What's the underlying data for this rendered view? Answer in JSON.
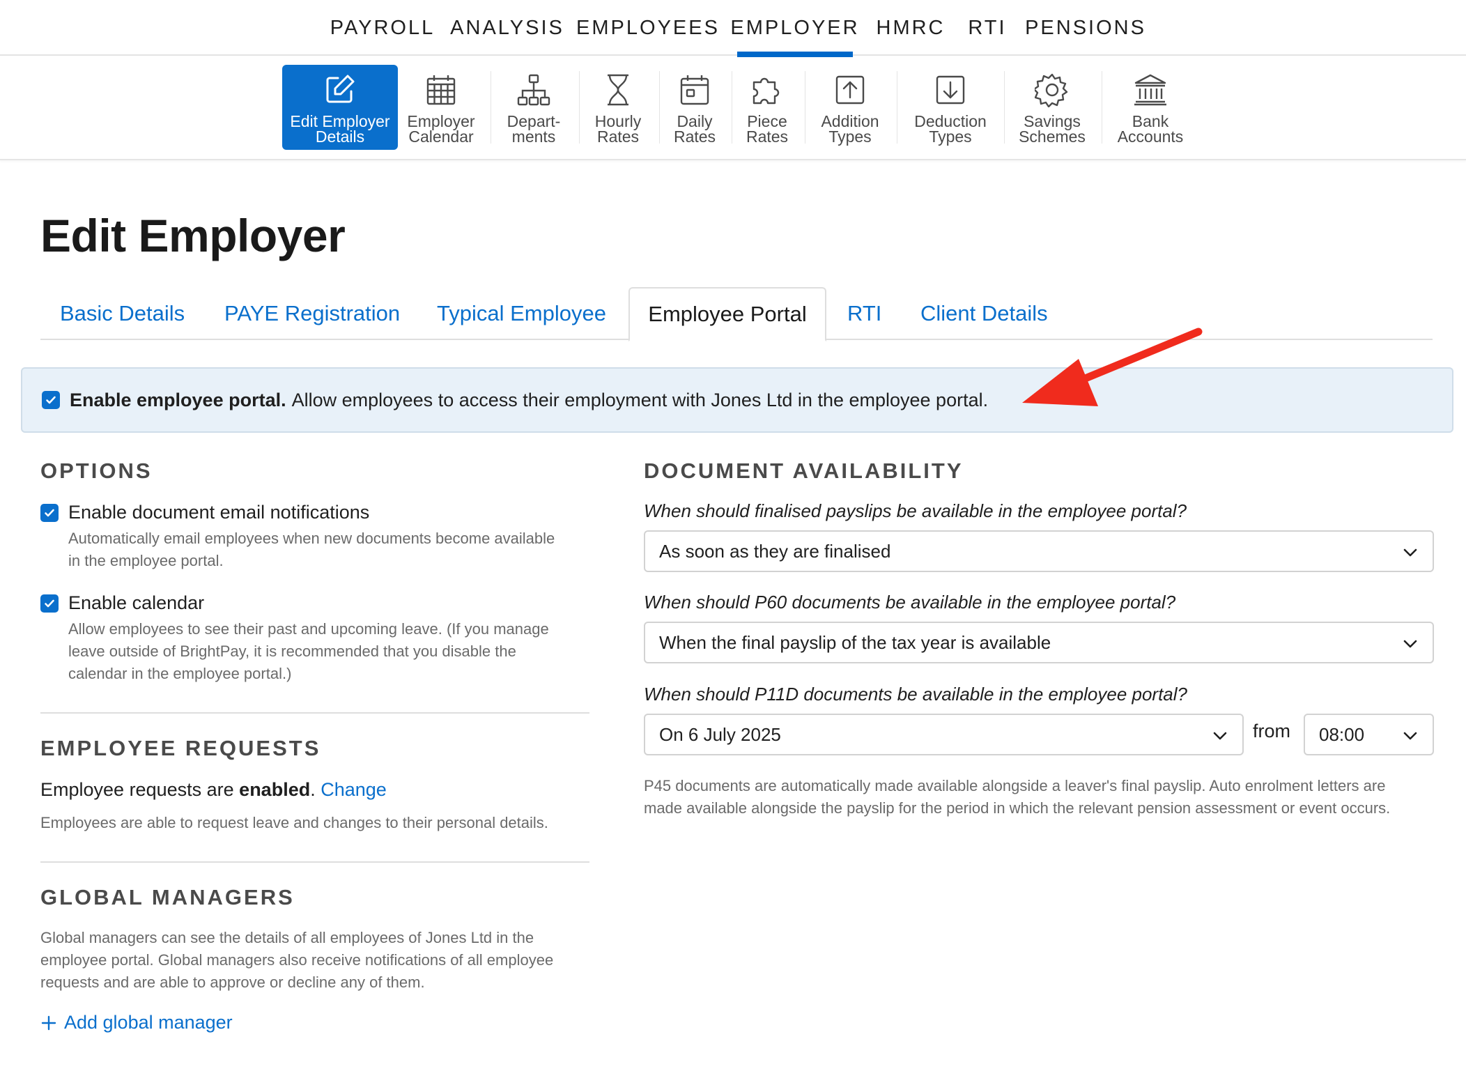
{
  "topnav": {
    "items": [
      {
        "label": "PAYROLL"
      },
      {
        "label": "ANALYSIS"
      },
      {
        "label": "EMPLOYEES"
      },
      {
        "label": "EMPLOYER"
      },
      {
        "label": "HMRC"
      },
      {
        "label": "RTI"
      },
      {
        "label": "PENSIONS"
      }
    ],
    "active": "EMPLOYER"
  },
  "toolbar": {
    "items": [
      {
        "line1": "Edit Employer",
        "line2": "Details",
        "icon": "edit-icon",
        "active": true
      },
      {
        "line1": "Employer",
        "line2": "Calendar",
        "icon": "calendar-grid-icon"
      },
      {
        "line1": "Depart-",
        "line2": "ments",
        "icon": "org-chart-icon"
      },
      {
        "line1": "Hourly",
        "line2": "Rates",
        "icon": "hourglass-icon"
      },
      {
        "line1": "Daily",
        "line2": "Rates",
        "icon": "calendar-day-icon"
      },
      {
        "line1": "Piece",
        "line2": "Rates",
        "icon": "puzzle-icon"
      },
      {
        "line1": "Addition",
        "line2": "Types",
        "icon": "arrow-up-box-icon"
      },
      {
        "line1": "Deduction",
        "line2": "Types",
        "icon": "arrow-down-box-icon"
      },
      {
        "line1": "Savings",
        "line2": "Schemes",
        "icon": "gear-icon"
      },
      {
        "line1": "Bank",
        "line2": "Accounts",
        "icon": "bank-icon"
      }
    ]
  },
  "page": {
    "title": "Edit Employer"
  },
  "tabs": [
    {
      "label": "Basic Details"
    },
    {
      "label": "PAYE Registration"
    },
    {
      "label": "Typical Employee"
    },
    {
      "label": "Employee Portal",
      "active": true
    },
    {
      "label": "RTI"
    },
    {
      "label": "Client Details"
    }
  ],
  "banner": {
    "checked": true,
    "bold": "Enable employee portal.",
    "text": "Allow employees to access their employment with Jones Ltd in the employee portal."
  },
  "options": {
    "heading": "OPTIONS",
    "items": [
      {
        "label": "Enable document email notifications",
        "checked": true,
        "desc_lines": [
          "Automatically email employees when new documents become available",
          "in the employee portal."
        ]
      },
      {
        "label": "Enable calendar",
        "checked": true,
        "desc_lines": [
          "Allow employees to see their past and upcoming leave. (If you manage",
          "leave outside of BrightPay, it is recommended that you disable the",
          "calendar in the employee portal.)"
        ]
      }
    ]
  },
  "requests": {
    "heading": "EMPLOYEE REQUESTS",
    "prefix": "Employee requests are",
    "state": "enabled",
    "suffix": ".",
    "change_link": "Change",
    "desc": "Employees are able to request leave and changes to their personal details."
  },
  "managers": {
    "heading": "GLOBAL MANAGERS",
    "desc_lines": [
      "Global managers can see the details of all employees of Jones Ltd in the",
      "employee portal. Global managers also receive notifications of all employee",
      "requests and are able to approve or decline any of them."
    ],
    "add_label": "Add global manager"
  },
  "availability": {
    "heading": "DOCUMENT AVAILABILITY",
    "payslips_q": "When should finalised payslips be available in the employee portal?",
    "payslips_value": "As soon as they are finalised",
    "p60_q": "When should P60 documents be available in the employee portal?",
    "p60_value": "When the final payslip of the tax year is available",
    "p11d_q": "When should P11D documents be available in the employee portal?",
    "p11d_value": "On 6 July 2025",
    "from_label": "from",
    "time_value": "08:00",
    "note_lines": [
      "P45 documents are automatically made available alongside a leaver's final payslip. Auto enrolment letters are",
      "made available alongside the payslip for the period in which the relevant pension assessment or event occurs."
    ]
  },
  "colors": {
    "accent": "#0a6fcc",
    "banner_bg": "#e8f1f9",
    "annotation_arrow": "#f02b1d"
  }
}
